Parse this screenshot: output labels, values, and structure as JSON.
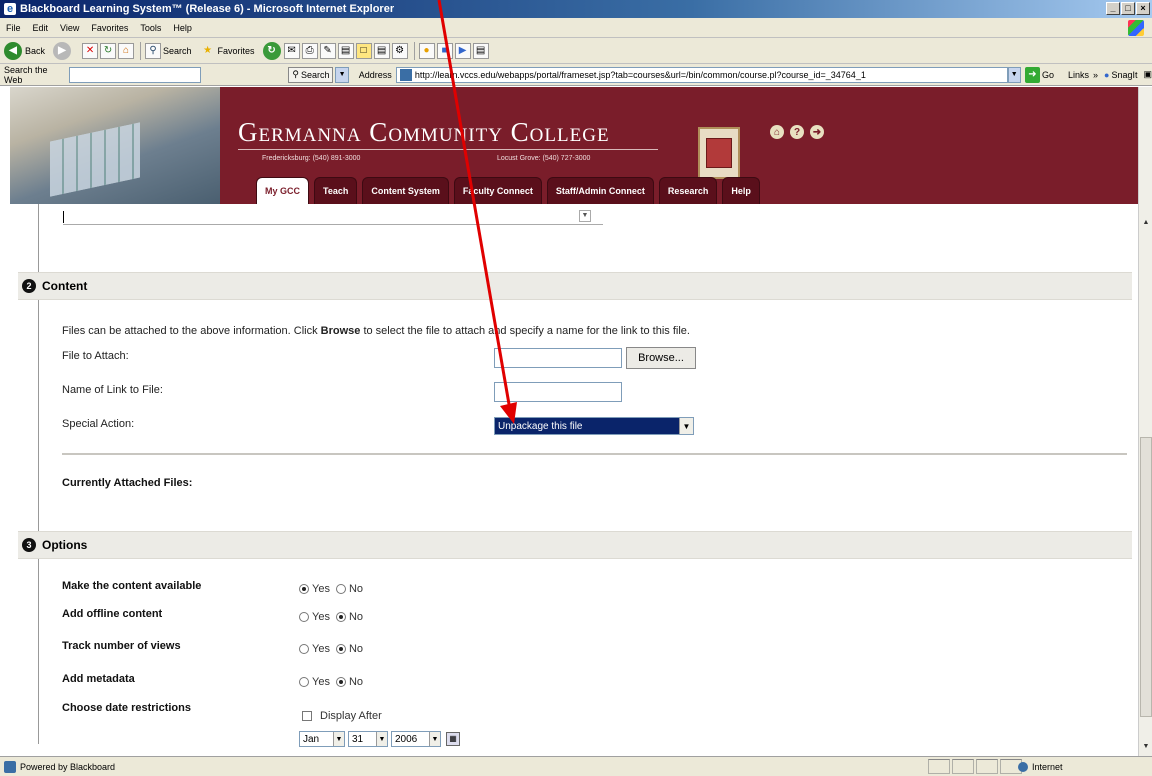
{
  "window": {
    "title": "Blackboard Learning System™ (Release 6) - Microsoft Internet Explorer",
    "min": "_",
    "max": "□",
    "close": "×"
  },
  "menu": [
    "File",
    "Edit",
    "View",
    "Favorites",
    "Tools",
    "Help"
  ],
  "toolbar": {
    "back": "Back",
    "search": "Search",
    "favorites": "Favorites"
  },
  "addressbar": {
    "search_label": "Search the Web",
    "search_button": "Search",
    "address_label": "Address",
    "url": "http://learn.vccs.edu/webapps/portal/frameset.jsp?tab=courses&url=/bin/common/course.pl?course_id=_34764_1",
    "go": "Go",
    "links": "Links",
    "snagit": "SnagIt"
  },
  "header": {
    "college": "Germanna Community College",
    "phone_fred": "Fredericksburg: (540) 891-3000",
    "phone_locust": "Locust Grove: (540) 727-3000",
    "tabs": [
      {
        "label": "My GCC",
        "active": true
      },
      {
        "label": "Teach",
        "active": false
      },
      {
        "label": "Content System",
        "active": false
      },
      {
        "label": "Faculty Connect",
        "active": false
      },
      {
        "label": "Staff/Admin Connect",
        "active": false
      },
      {
        "label": "Research",
        "active": false
      },
      {
        "label": "Help",
        "active": false
      }
    ]
  },
  "content_section": {
    "number": "2",
    "title": "Content",
    "instructions_pre": "Files can be attached to the above information. Click ",
    "instructions_bold": "Browse",
    "instructions_post": " to select the file to attach and specify a name for the link to this file.",
    "file_label": "File to Attach:",
    "browse_button": "Browse...",
    "name_label": "Name of Link to File:",
    "action_label": "Special Action:",
    "action_value": "Unpackage this file",
    "attached_label": "Currently Attached Files:"
  },
  "options_section": {
    "number": "3",
    "title": "Options",
    "rows": [
      {
        "label": "Make the content available",
        "yes": "Yes",
        "no": "No",
        "selected": "yes"
      },
      {
        "label": "Add offline content",
        "yes": "Yes",
        "no": "No",
        "selected": "no"
      },
      {
        "label": "Track number of views",
        "yes": "Yes",
        "no": "No",
        "selected": "no"
      },
      {
        "label": "Add metadata",
        "yes": "Yes",
        "no": "No",
        "selected": "no"
      }
    ],
    "date_label": "Choose date restrictions",
    "display_after": "Display After",
    "month": "Jan",
    "day": "31",
    "year": "2006"
  },
  "status": {
    "text": "Powered by Blackboard",
    "zone": "Internet"
  },
  "colors": {
    "maroon": "#7a1d2a",
    "arrow": "#e00000",
    "highlight": "#0a246a"
  }
}
